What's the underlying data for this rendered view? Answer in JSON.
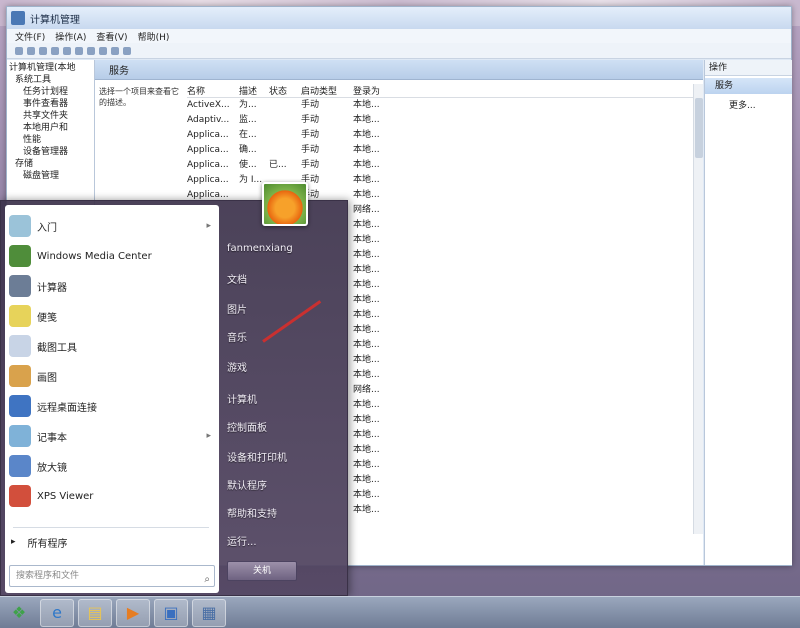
{
  "window": {
    "title": "计算机管理",
    "menu": [
      "文件(F)",
      "操作(A)",
      "查看(V)",
      "帮助(H)"
    ]
  },
  "tree": {
    "items": [
      "计算机管理(本地",
      "系统工具",
      "任务计划程",
      "事件查看器",
      "共享文件夹",
      "本地用户和",
      "性能",
      "设备管理器",
      "存储",
      "磁盘管理"
    ]
  },
  "services": {
    "header": "服务",
    "description": "选择一个项目来查看它的描述。",
    "columns": [
      "名称",
      "描述",
      "状态",
      "启动类型",
      "登录为"
    ],
    "rows": [
      [
        "ActiveX...",
        "为...",
        "",
        "手动",
        "本地..."
      ],
      [
        "Adaptiv...",
        "监...",
        "",
        "手动",
        "本地..."
      ],
      [
        "Applica...",
        "在...",
        "",
        "手动",
        "本地..."
      ],
      [
        "Applica...",
        "确...",
        "",
        "手动",
        "本地..."
      ],
      [
        "Applica...",
        "使...",
        "已...",
        "手动",
        "本地..."
      ],
      [
        "Applica...",
        "为 I...",
        "",
        "手动",
        "本地..."
      ],
      [
        "Applica...",
        "",
        "",
        "手动",
        "本地..."
      ],
      [
        "",
        "",
        "",
        "",
        "网络..."
      ],
      [
        "",
        "",
        "",
        "",
        "本地..."
      ],
      [
        "",
        "",
        "",
        "",
        "本地..."
      ],
      [
        "",
        "",
        "",
        "",
        "本地..."
      ],
      [
        "",
        "",
        "",
        "",
        "本地..."
      ],
      [
        "",
        "",
        "",
        "",
        "本地..."
      ],
      [
        "",
        "",
        "",
        "",
        "本地..."
      ],
      [
        "",
        "",
        "",
        "",
        "本地..."
      ],
      [
        "",
        "",
        "",
        "",
        "本地..."
      ],
      [
        "",
        "",
        "",
        "",
        "本地..."
      ],
      [
        "",
        "",
        "",
        "",
        "本地..."
      ],
      [
        "",
        "",
        "",
        "",
        "本地..."
      ],
      [
        "",
        "",
        "",
        "",
        "网络..."
      ],
      [
        "",
        "",
        "",
        "",
        "本地..."
      ],
      [
        "",
        "",
        "",
        "",
        "本地..."
      ],
      [
        "",
        "",
        "",
        "",
        "本地..."
      ],
      [
        "",
        "",
        "",
        "",
        "本地..."
      ],
      [
        "",
        "",
        "",
        "",
        "本地..."
      ],
      [
        "",
        "",
        "",
        "",
        "本地..."
      ],
      [
        "",
        "",
        "",
        "",
        "本地..."
      ],
      [
        "",
        "",
        "",
        "",
        "本地..."
      ]
    ]
  },
  "actions": {
    "header": "操作",
    "selected": "服务",
    "more": "更多..."
  },
  "startmenu": {
    "programs": [
      {
        "label": "入门",
        "icon": "getting-started-icon",
        "color": "#9bc3d9",
        "arrow": "▸"
      },
      {
        "label": "Windows Media Center",
        "icon": "media-center-icon",
        "color": "#4f8d3a",
        "arrow": ""
      },
      {
        "label": "计算器",
        "icon": "calculator-icon",
        "color": "#6c7d96",
        "arrow": ""
      },
      {
        "label": "便笺",
        "icon": "sticky-notes-icon",
        "color": "#e7d35a",
        "arrow": ""
      },
      {
        "label": "截图工具",
        "icon": "snipping-tool-icon",
        "color": "#c8d4e6",
        "arrow": ""
      },
      {
        "label": "画图",
        "icon": "paint-icon",
        "color": "#d9a24c",
        "arrow": ""
      },
      {
        "label": "远程桌面连接",
        "icon": "remote-desktop-icon",
        "color": "#3f74c2",
        "arrow": ""
      },
      {
        "label": "记事本",
        "icon": "notepad-icon",
        "color": "#7fb2d8",
        "arrow": "▸"
      },
      {
        "label": "放大镜",
        "icon": "magnifier-icon",
        "color": "#5a86c9",
        "arrow": ""
      },
      {
        "label": "XPS Viewer",
        "icon": "xps-viewer-icon",
        "color": "#d24f3c",
        "arrow": ""
      }
    ],
    "all_programs": "所有程序",
    "search_placeholder": "搜索程序和文件",
    "right": [
      "fanmenxiang",
      "文档",
      "图片",
      "音乐",
      "游戏",
      "计算机",
      "控制面板",
      "设备和打印机",
      "默认程序",
      "帮助和支持",
      "运行..."
    ],
    "shutdown": "关机"
  },
  "taskbar": {
    "items": [
      {
        "icon": "start-orb-icon",
        "glyph": "❖",
        "color": "#3fa24a"
      },
      {
        "icon": "internet-explorer-icon",
        "glyph": "e",
        "color": "#2f78c9"
      },
      {
        "icon": "explorer-folder-icon",
        "glyph": "▤",
        "color": "#e9c553"
      },
      {
        "icon": "media-player-icon",
        "glyph": "▶",
        "color": "#e67d22"
      },
      {
        "icon": "remote-desktop-task-icon",
        "glyph": "▣",
        "color": "#3a6fbf"
      },
      {
        "icon": "computer-management-task-icon",
        "glyph": "▦",
        "color": "#4a6fa5"
      }
    ]
  }
}
